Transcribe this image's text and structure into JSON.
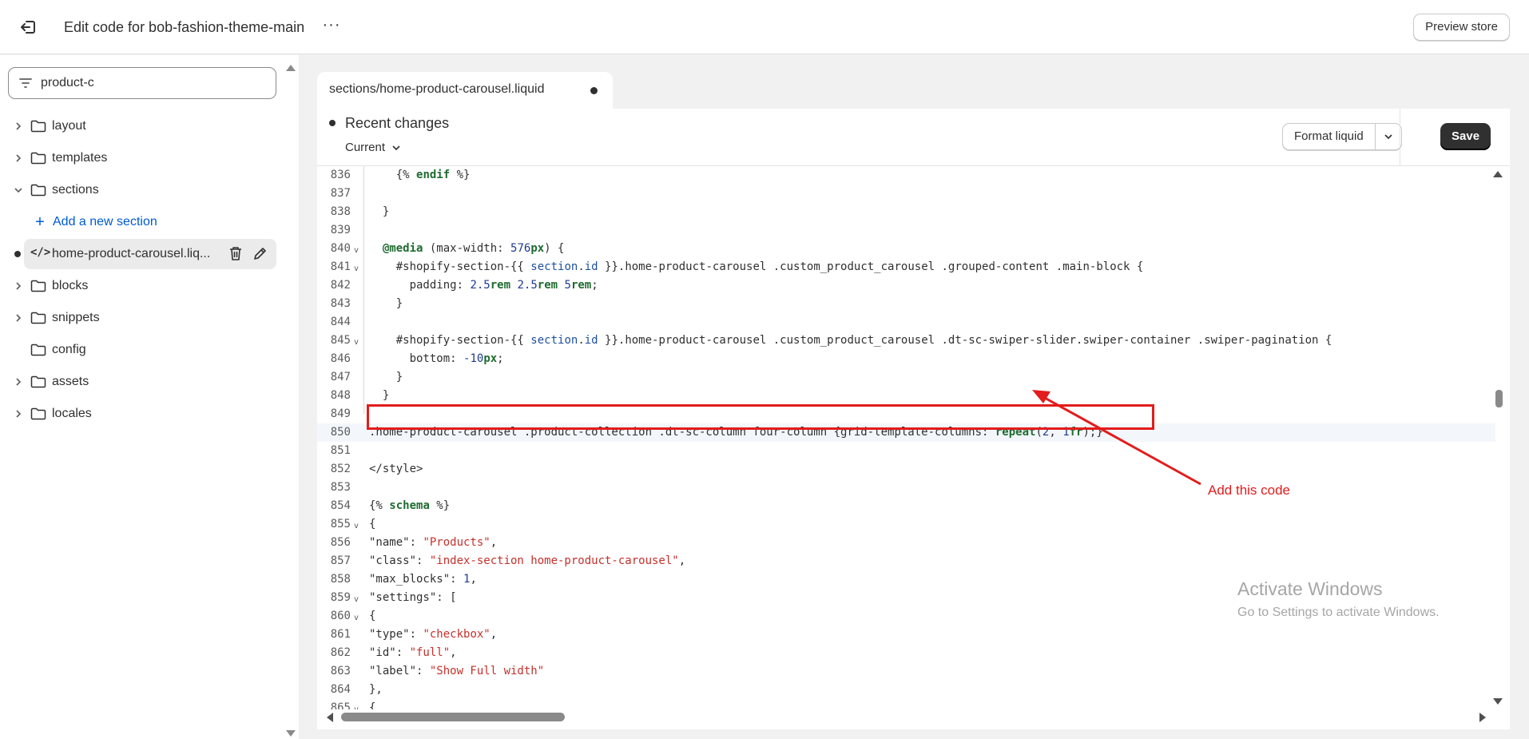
{
  "header": {
    "title": "Edit code for bob-fashion-theme-main",
    "more_label": "···",
    "preview_label": "Preview store"
  },
  "sidebar": {
    "filter_value": "product-c",
    "items": [
      {
        "label": "layout"
      },
      {
        "label": "templates"
      },
      {
        "label": "sections"
      },
      {
        "label": "blocks"
      },
      {
        "label": "snippets"
      },
      {
        "label": "config"
      },
      {
        "label": "assets"
      },
      {
        "label": "locales"
      }
    ],
    "add_section_label": "Add a new section",
    "open_file": "home-product-carousel.liq..."
  },
  "tab": {
    "path_prefix": "sections/",
    "filename": "home-product-carousel.liquid"
  },
  "changes": {
    "title": "Recent changes",
    "current_label": "Current",
    "format_label": "Format liquid",
    "save_label": "Save"
  },
  "code_lines": [
    {
      "n": "836",
      "html": "    {% <span class=\"kw\">endif</span> %}"
    },
    {
      "n": "837",
      "html": ""
    },
    {
      "n": "838",
      "html": "  }"
    },
    {
      "n": "839",
      "html": ""
    },
    {
      "n": "840",
      "fold": true,
      "html": "  <span class=\"kw\">@media</span> (max-width: <span class=\"num\">576</span><span class=\"kw\">px</span>) {"
    },
    {
      "n": "841",
      "fold": true,
      "html": "    #shopify-section-{{ <span class=\"var\">section</span>.<span class=\"var\">id</span> }}.home-product-carousel .custom_product_carousel .grouped-content .main-block {"
    },
    {
      "n": "842",
      "html": "      padding: <span class=\"num\">2.5</span><span class=\"kw\">rem</span> <span class=\"num\">2.5</span><span class=\"kw\">rem</span> <span class=\"num\">5</span><span class=\"kw\">rem</span>;"
    },
    {
      "n": "843",
      "html": "    }"
    },
    {
      "n": "844",
      "html": ""
    },
    {
      "n": "845",
      "fold": true,
      "html": "    #shopify-section-{{ <span class=\"var\">section</span>.<span class=\"var\">id</span> }}.home-product-carousel .custom_product_carousel .dt-sc-swiper-slider.swiper-container .swiper-pagination {"
    },
    {
      "n": "846",
      "html": "      bottom: <span class=\"num\">-10</span><span class=\"kw\">px</span>;"
    },
    {
      "n": "847",
      "html": "    }"
    },
    {
      "n": "848",
      "html": "  }"
    },
    {
      "n": "849",
      "html": ""
    },
    {
      "n": "850",
      "active": true,
      "html": ".home-product-carousel .product-collection .dt-sc-column four-column {grid-template-columns: <span class=\"kw\">repeat</span>(<span class=\"num\">2</span>, <span class=\"num\">1</span><span class=\"kw\">fr</span>);}"
    },
    {
      "n": "851",
      "html": ""
    },
    {
      "n": "852",
      "html": "&lt;/style&gt;"
    },
    {
      "n": "853",
      "html": ""
    },
    {
      "n": "854",
      "html": "{% <span class=\"kw\">schema</span> %}"
    },
    {
      "n": "855",
      "fold": true,
      "html": "{"
    },
    {
      "n": "856",
      "html": "\"name\": <span class=\"str\">\"Products\"</span>,"
    },
    {
      "n": "857",
      "html": "\"class\": <span class=\"str\">\"index-section home-product-carousel\"</span>,"
    },
    {
      "n": "858",
      "html": "\"max_blocks\": <span class=\"num\">1</span>,"
    },
    {
      "n": "859",
      "fold": true,
      "html": "\"settings\": ["
    },
    {
      "n": "860",
      "fold": true,
      "html": "{"
    },
    {
      "n": "861",
      "html": "\"type\": <span class=\"str\">\"checkbox\"</span>,"
    },
    {
      "n": "862",
      "html": "\"id\": <span class=\"str\">\"full\"</span>,"
    },
    {
      "n": "863",
      "html": "\"label\": <span class=\"str\">\"Show Full width\"</span>"
    },
    {
      "n": "864",
      "html": "},"
    },
    {
      "n": "865",
      "fold": true,
      "html": "{"
    }
  ],
  "annotation": {
    "text": "Add this code",
    "color": "#e31c1c"
  },
  "watermark": {
    "line1": "Activate Windows",
    "line2": "Go to Settings to activate Windows."
  }
}
